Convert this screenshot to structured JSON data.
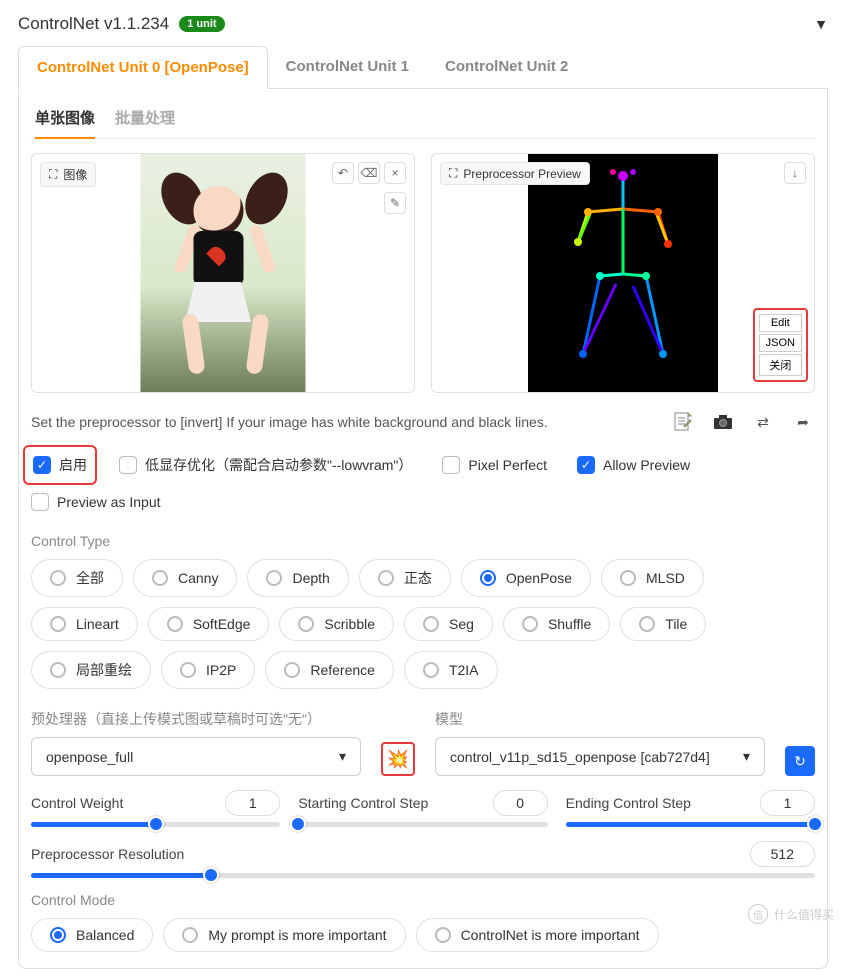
{
  "header": {
    "title": "ControlNet v1.1.234",
    "badge": "1 unit"
  },
  "unit_tabs": {
    "items": [
      "ControlNet Unit 0 [OpenPose]",
      "ControlNet Unit 1",
      "ControlNet Unit 2"
    ],
    "active": 0
  },
  "image_tabs": {
    "items": [
      "单张图像",
      "批量处理"
    ],
    "active": 0
  },
  "image_panel": {
    "label": "图像",
    "undo_icon": "↶",
    "clear_icon": "⌫",
    "close_icon": "×",
    "pencil_icon": "✎"
  },
  "preview_panel": {
    "label": "Preprocessor Preview",
    "download_icon": "↓",
    "edit_label": "Edit",
    "json_label": "JSON",
    "close_label": "关闭"
  },
  "hint_text": "Set the preprocessor to [invert] If your image has white background and black lines.",
  "hint_icons": {
    "doc": "📄",
    "camera": "📷",
    "swap": "⇄",
    "send": "➦"
  },
  "enable_row": {
    "enable": {
      "label": "启用",
      "checked": true
    },
    "lowvram": {
      "label": "低显存优化（需配合启动参数\"--lowvram\"）",
      "checked": false
    },
    "pixel_perfect": {
      "label": "Pixel Perfect",
      "checked": false
    },
    "allow_preview": {
      "label": "Allow Preview",
      "checked": true
    }
  },
  "preview_as_input": {
    "label": "Preview as Input",
    "checked": false
  },
  "control_type": {
    "label": "Control Type",
    "options": [
      "全部",
      "Canny",
      "Depth",
      "正态",
      "OpenPose",
      "MLSD",
      "Lineart",
      "SoftEdge",
      "Scribble",
      "Seg",
      "Shuffle",
      "Tile",
      "局部重绘",
      "IP2P",
      "Reference",
      "T2IA"
    ],
    "selected": "OpenPose"
  },
  "preprocessor": {
    "label": "预处理器（直接上传模式图或草稿时可选\"无\"）",
    "value": "openpose_full"
  },
  "explode_icon": "💥",
  "model": {
    "label": "模型",
    "value": "control_v11p_sd15_openpose [cab727d4]"
  },
  "refresh_icon": "↻",
  "sliders": {
    "control_weight": {
      "label": "Control Weight",
      "value": "1",
      "fill": 50
    },
    "start_step": {
      "label": "Starting Control Step",
      "value": "0",
      "fill": 0
    },
    "end_step": {
      "label": "Ending Control Step",
      "value": "1",
      "fill": 100
    },
    "resolution": {
      "label": "Preprocessor Resolution",
      "value": "512",
      "fill": 23
    }
  },
  "control_mode": {
    "label": "Control Mode",
    "options": [
      "Balanced",
      "My prompt is more important",
      "ControlNet is more important"
    ],
    "selected": "Balanced"
  },
  "watermark": "什么值得买"
}
